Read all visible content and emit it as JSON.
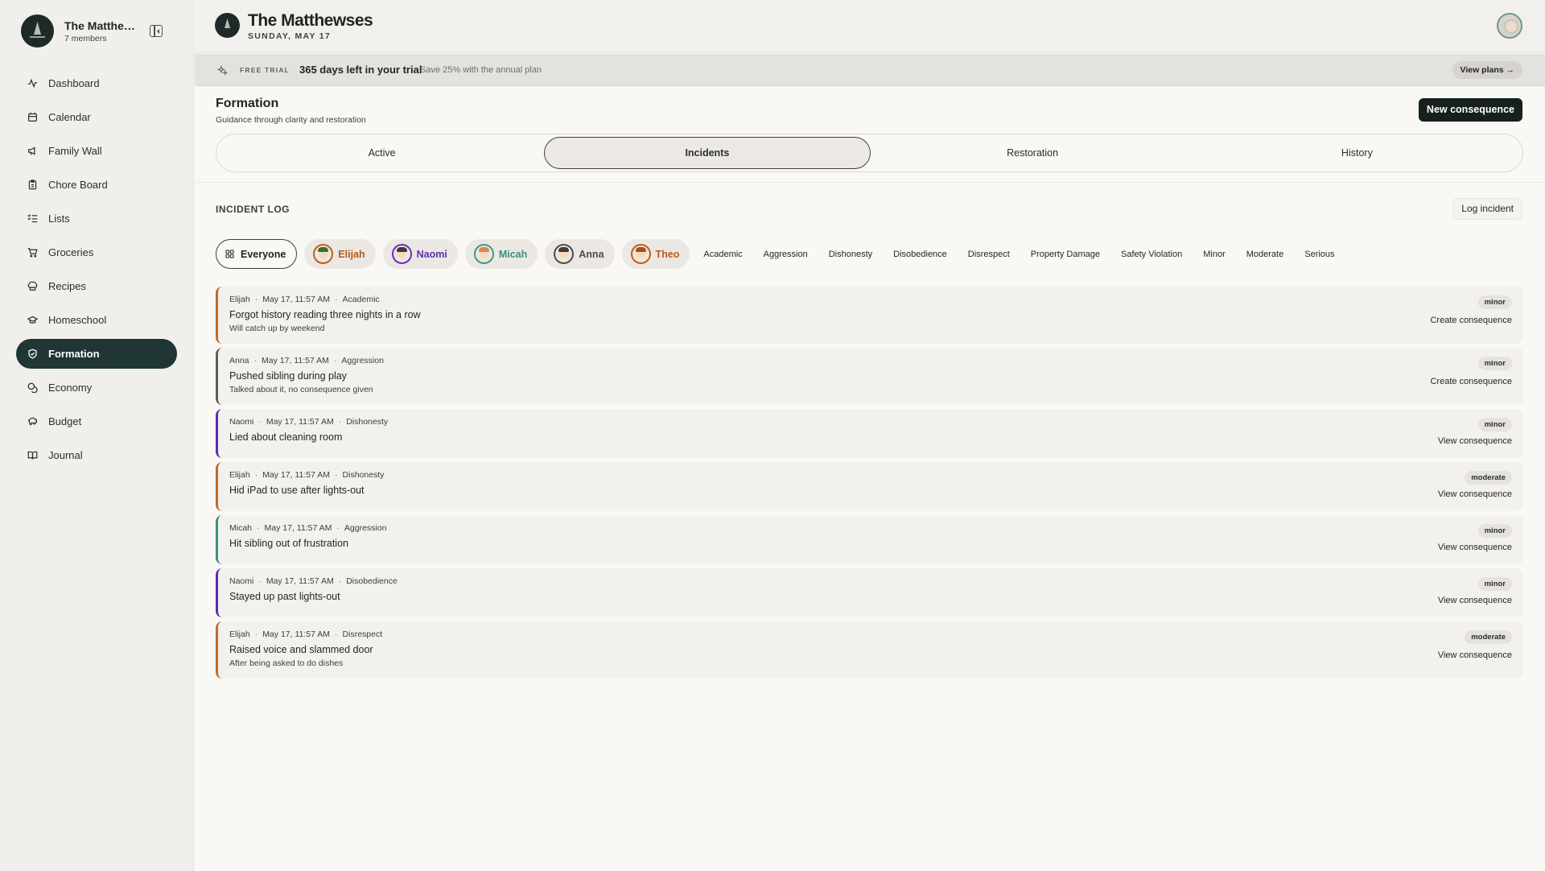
{
  "sidebar": {
    "family_name": "The Matthe…",
    "member_count": "7 members",
    "items": [
      {
        "label": "Dashboard",
        "icon": "activity-icon"
      },
      {
        "label": "Calendar",
        "icon": "calendar-icon"
      },
      {
        "label": "Family Wall",
        "icon": "megaphone-icon"
      },
      {
        "label": "Chore Board",
        "icon": "clipboard-icon"
      },
      {
        "label": "Lists",
        "icon": "list-icon"
      },
      {
        "label": "Groceries",
        "icon": "cart-icon"
      },
      {
        "label": "Recipes",
        "icon": "chef-hat-icon"
      },
      {
        "label": "Homeschool",
        "icon": "graduation-cap-icon"
      },
      {
        "label": "Formation",
        "icon": "shield-icon",
        "active": true
      },
      {
        "label": "Economy",
        "icon": "coins-icon"
      },
      {
        "label": "Budget",
        "icon": "piggy-bank-icon"
      },
      {
        "label": "Journal",
        "icon": "book-icon"
      }
    ]
  },
  "header": {
    "title": "The Matthewses",
    "date": "SUNDAY, MAY 17"
  },
  "trial": {
    "label": "FREE TRIAL",
    "main": "365 days left in your trial",
    "sub": "Save 25% with the annual plan",
    "button": "View plans →"
  },
  "page": {
    "title": "Formation",
    "subtitle": "Guidance through clarity and restoration",
    "primary_button": "New consequence"
  },
  "tabs": [
    {
      "label": "Active"
    },
    {
      "label": "Incidents",
      "active": true
    },
    {
      "label": "Restoration"
    },
    {
      "label": "History"
    }
  ],
  "incident_log": {
    "heading": "INCIDENT LOG",
    "log_button": "Log incident",
    "people": [
      {
        "label": "Everyone"
      },
      {
        "label": "Elijah",
        "color": "#b65a17"
      },
      {
        "label": "Naomi",
        "color": "#5d2db2"
      },
      {
        "label": "Micah",
        "color": "#3b8e7c"
      },
      {
        "label": "Anna",
        "color": "#4a4d4c"
      },
      {
        "label": "Theo",
        "color": "#b65a17"
      }
    ],
    "categories": [
      "Academic",
      "Aggression",
      "Dishonesty",
      "Disobedience",
      "Disrespect",
      "Property Damage",
      "Safety Violation",
      "Minor",
      "Moderate",
      "Serious"
    ],
    "incidents": [
      {
        "person": "Elijah",
        "time": "May 17, 11:57 AM",
        "category": "Academic",
        "title": "Forgot history reading three nights in a row",
        "note": "Will catch up by weekend",
        "severity": "minor",
        "action": "Create consequence"
      },
      {
        "person": "Anna",
        "time": "May 17, 11:57 AM",
        "category": "Aggression",
        "title": "Pushed sibling during play",
        "note": "Talked about it, no consequence given",
        "severity": "minor",
        "action": "Create consequence"
      },
      {
        "person": "Naomi",
        "time": "May 17, 11:57 AM",
        "category": "Dishonesty",
        "title": "Lied about cleaning room",
        "note": "",
        "severity": "minor",
        "action": "View consequence"
      },
      {
        "person": "Elijah",
        "time": "May 17, 11:57 AM",
        "category": "Dishonesty",
        "title": "Hid iPad to use after lights-out",
        "note": "",
        "severity": "moderate",
        "action": "View consequence"
      },
      {
        "person": "Micah",
        "time": "May 17, 11:57 AM",
        "category": "Aggression",
        "title": "Hit sibling out of frustration",
        "note": "",
        "severity": "minor",
        "action": "View consequence"
      },
      {
        "person": "Naomi",
        "time": "May 17, 11:57 AM",
        "category": "Disobedience",
        "title": "Stayed up past lights-out",
        "note": "",
        "severity": "minor",
        "action": "View consequence"
      },
      {
        "person": "Elijah",
        "time": "May 17, 11:57 AM",
        "category": "Disrespect",
        "title": "Raised voice and slammed door",
        "note": "After being asked to do dishes",
        "severity": "moderate",
        "action": "View consequence"
      }
    ]
  }
}
